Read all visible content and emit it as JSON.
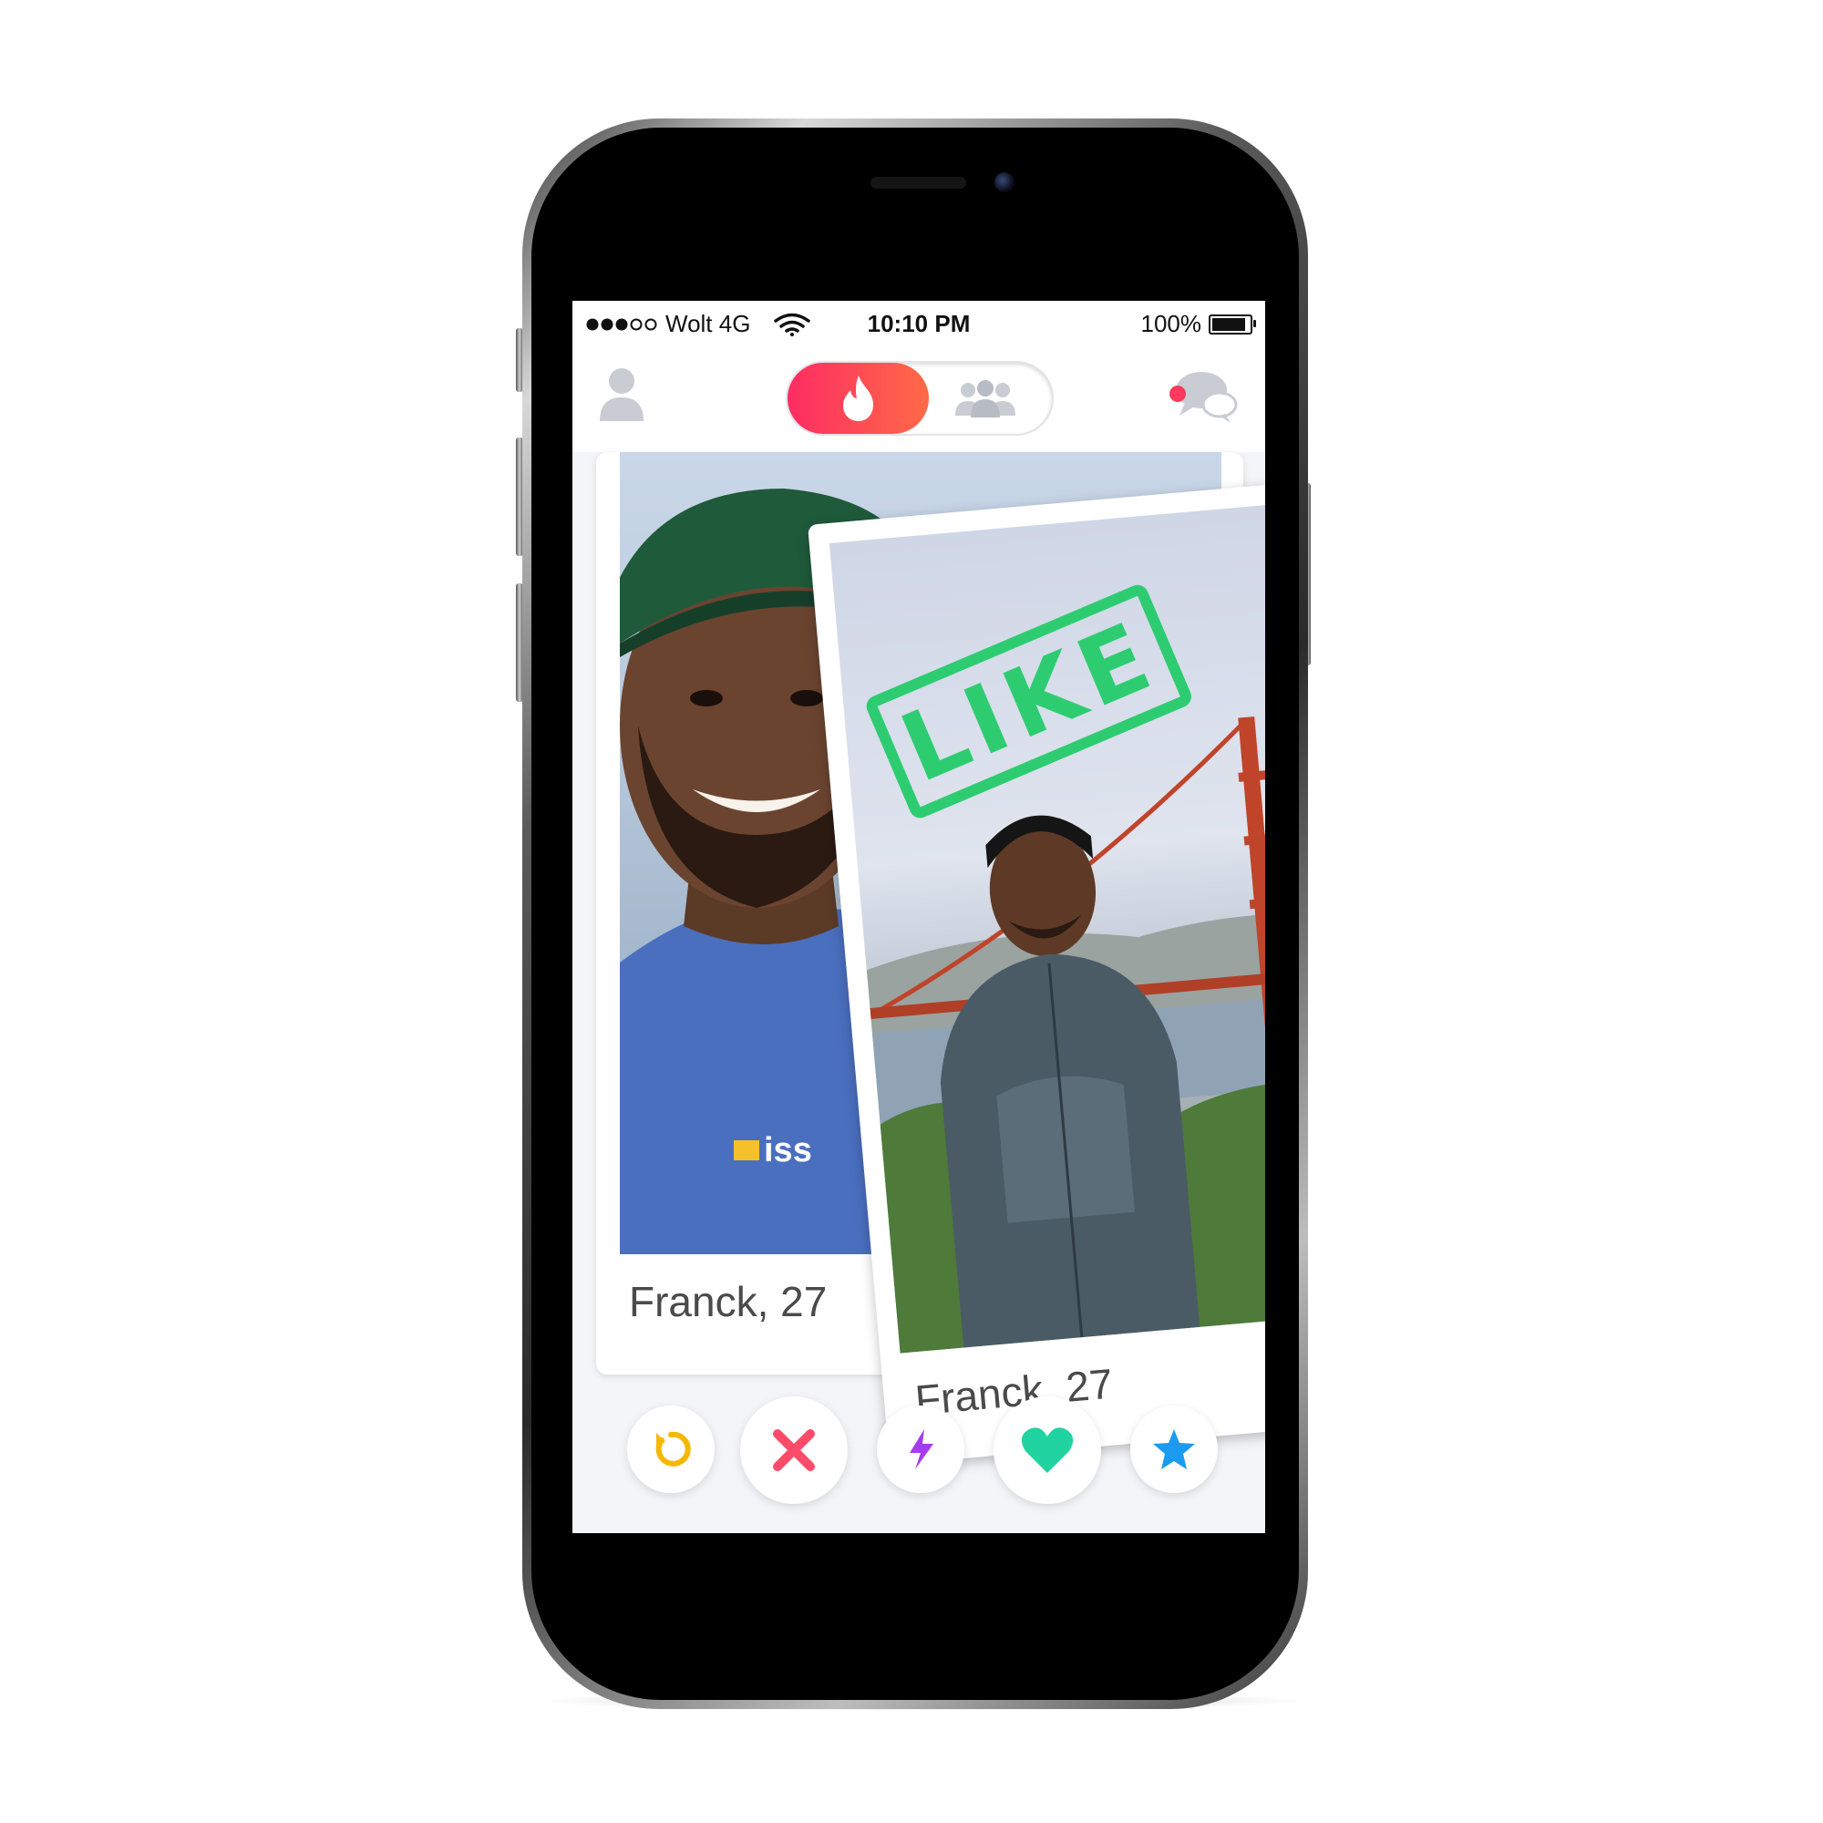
{
  "status_bar": {
    "carrier": "Wolt 4G",
    "time": "10:10 PM",
    "battery": "100%",
    "battery_level": 1.0,
    "signal_bars": 3,
    "signal_total": 5
  },
  "top_nav": {
    "active_mode": "discovery",
    "notification_color": "#fd3a5c"
  },
  "cards": {
    "back": {
      "caption": "Franck, 27",
      "shirt_logo": "iss"
    },
    "front": {
      "caption": "Franck, 27",
      "stamp": "LIKE"
    }
  },
  "actions": [
    {
      "name": "rewind",
      "icon": "rewind-icon",
      "color": "#f5b800"
    },
    {
      "name": "nope",
      "icon": "close-icon",
      "color": "#fd4b6a"
    },
    {
      "name": "boost",
      "icon": "lightning-icon",
      "color": "#a53bf0"
    },
    {
      "name": "like",
      "icon": "heart-icon",
      "color": "#21d3a0"
    },
    {
      "name": "super-like",
      "icon": "star-icon",
      "color": "#1a9bf0"
    }
  ],
  "colors": {
    "brand_gradient_start": "#fd2c63",
    "brand_gradient_end": "#ff6a47",
    "like_stamp": "#2ecc71"
  }
}
